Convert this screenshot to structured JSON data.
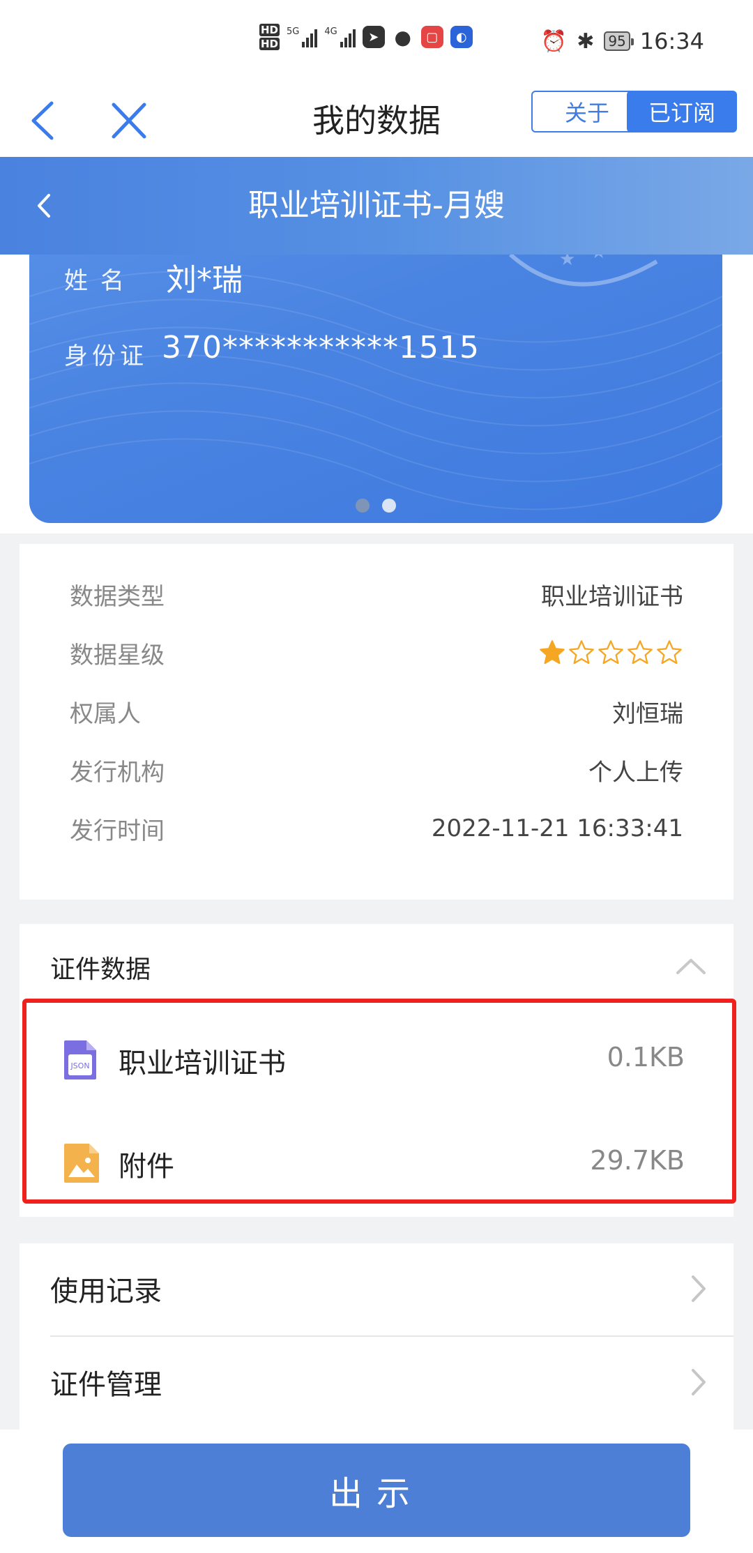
{
  "status_bar": {
    "time": "16:34",
    "battery": "95",
    "hd1": "HD",
    "hd2": "HD",
    "net1": "5G",
    "net2": "4G"
  },
  "nav": {
    "title": "我的数据",
    "about_label": "关于",
    "subscribed_label": "已订阅"
  },
  "sub_header": {
    "title": "职业培训证书-月嫂"
  },
  "card": {
    "name_label": "姓名",
    "name_value": "刘*瑞",
    "id_label": "身份证",
    "id_value": "370***********1515",
    "page_index": 2,
    "page_count": 2
  },
  "info": {
    "rows": [
      {
        "label": "数据类型",
        "value": "职业培训证书"
      },
      {
        "label": "数据星级",
        "stars_filled": 1,
        "stars_total": 5
      },
      {
        "label": "权属人",
        "value": "刘恒瑞"
      },
      {
        "label": "发行机构",
        "value": "个人上传"
      },
      {
        "label": "发行时间",
        "value": "2022-11-21 16:33:41"
      }
    ]
  },
  "cert_data": {
    "title": "证件数据",
    "files": [
      {
        "icon": "json-file-icon",
        "name": "职业培训证书",
        "size": "0.1KB"
      },
      {
        "icon": "image-file-icon",
        "name": "附件",
        "size": "29.7KB"
      }
    ]
  },
  "records": {
    "items": [
      "使用记录",
      "证件管理"
    ]
  },
  "bottom": {
    "show_label": "出示"
  },
  "colors": {
    "accent": "#3a7ceb",
    "header_blue": "#4a82e0",
    "highlight_red": "#f0211c",
    "star_orange": "#f5a623",
    "show_button": "#4e7fd7"
  }
}
